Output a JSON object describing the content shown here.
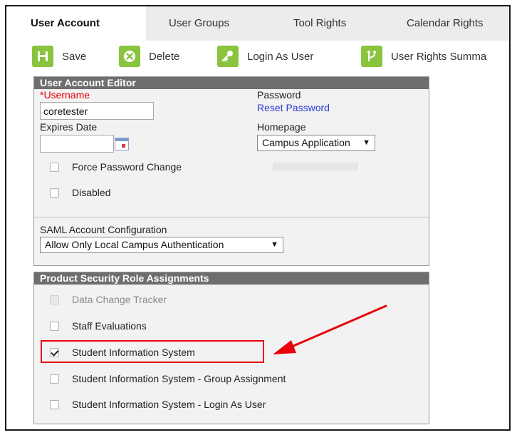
{
  "tabs": [
    {
      "label": "User Account",
      "active": true
    },
    {
      "label": "User Groups",
      "active": false
    },
    {
      "label": "Tool Rights",
      "active": false
    },
    {
      "label": "Calendar Rights",
      "active": false
    }
  ],
  "toolbar": {
    "save": "Save",
    "delete": "Delete",
    "login_as_user": "Login As User",
    "user_rights_summary": "User Rights Summa"
  },
  "editor": {
    "header": "User Account Editor",
    "username_label": "*Username",
    "username_value": "coretester",
    "password_label": "Password",
    "reset_password": "Reset Password",
    "expires_label": "Expires Date",
    "expires_value": "",
    "homepage_label": "Homepage",
    "homepage_value": "Campus Application",
    "force_password_change": "Force Password Change",
    "disabled": "Disabled",
    "saml_label": "SAML Account Configuration",
    "saml_value": "Allow Only Local Campus Authentication"
  },
  "roles": {
    "header": "Product Security Role Assignments",
    "items": [
      {
        "label": "Data Change Tracker",
        "checked": false,
        "disabled": true
      },
      {
        "label": "Staff Evaluations",
        "checked": false,
        "disabled": false
      },
      {
        "label": "Student Information System",
        "checked": true,
        "disabled": false
      },
      {
        "label": "Student Information System - Group Assignment",
        "checked": false,
        "disabled": false
      },
      {
        "label": "Student Information System - Login As User",
        "checked": false,
        "disabled": false
      }
    ]
  },
  "colors": {
    "accent_green": "#8ac43f",
    "header_gray": "#6e6e6e",
    "highlight_red": "#e8000b",
    "link_blue": "#2a3bd9"
  }
}
